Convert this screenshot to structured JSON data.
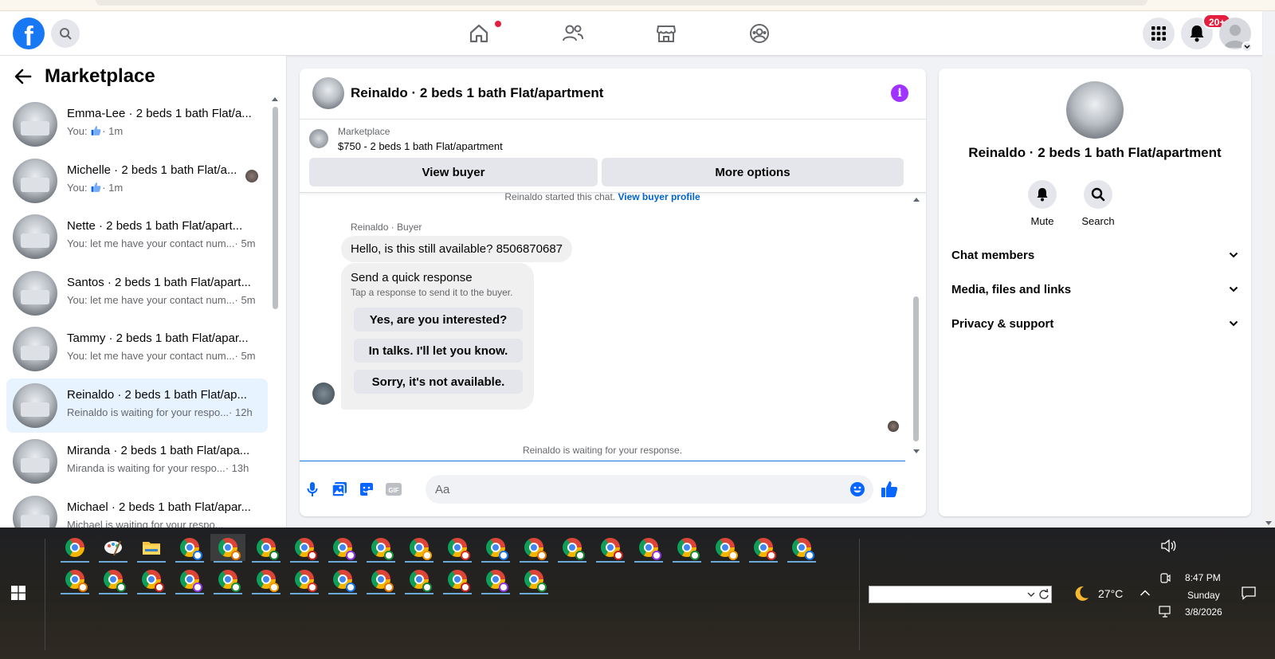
{
  "topnav": {
    "logo": "f",
    "notif_badge": "20+"
  },
  "marketplace": {
    "title": "Marketplace",
    "conversations": [
      {
        "name": "Emma-Lee · 2 beds 1 bath Flat/a...",
        "preview": "You: ",
        "preview_icon": "thumbs-up-icon",
        "time": "· 1m",
        "active": false
      },
      {
        "name": "Michelle · 2 beds 1 bath Flat/a...",
        "preview": "You: ",
        "preview_icon": "thumbs-up-icon",
        "time": "· 1m",
        "active": false
      },
      {
        "name": "Nette · 2 beds 1 bath Flat/apart...",
        "preview": "You: let me have your contact num...",
        "time": "· 5m",
        "active": false
      },
      {
        "name": "Santos · 2 beds 1 bath Flat/apart...",
        "preview": "You: let me have your contact num...",
        "time": "· 5m",
        "active": false
      },
      {
        "name": "Tammy · 2 beds 1 bath Flat/apar...",
        "preview": "You: let me have your contact num...",
        "time": "· 5m",
        "active": false
      },
      {
        "name": "Reinaldo · 2 beds 1 bath Flat/ap...",
        "preview": "Reinaldo is waiting for your respo...",
        "time": "· 12h",
        "active": true
      },
      {
        "name": "Miranda · 2 beds 1 bath Flat/apa...",
        "preview": "Miranda is waiting for your respo...",
        "time": "· 13h",
        "active": false
      },
      {
        "name": "Michael · 2 beds 1 bath Flat/apar...",
        "preview": "Michael is waiting for your respo...",
        "time": "",
        "active": false
      }
    ]
  },
  "chat": {
    "title": "Reinaldo · 2 beds 1 bath Flat/apartment",
    "listing_label": "Marketplace",
    "listing_price": "$750 - 2 beds 1 bath Flat/apartment",
    "view_buyer": "View buyer",
    "more_options": "More options",
    "started_text": "Reinaldo started this chat.",
    "view_buyer_profile": "View buyer profile",
    "sender_label": "Reinaldo · Buyer",
    "message": "Hello, is this still available? 8506870687",
    "quick_title": "Send a quick response",
    "quick_sub": "Tap a response to send it to the buyer.",
    "quick_options": [
      "Yes, are you interested?",
      "In talks. I'll let you know.",
      "Sorry, it's not available."
    ],
    "waiting": "Reinaldo is waiting for your response.",
    "composer_placeholder": "Aa",
    "accent_color": "#0866ff"
  },
  "details": {
    "name": "Reinaldo · 2 beds 1 bath Flat/apartment",
    "mute": "Mute",
    "search": "Search",
    "sections": [
      "Chat members",
      "Media, files and links",
      "Privacy & support"
    ]
  },
  "taskbar": {
    "temperature": "27°C",
    "time": "8:47 PM",
    "day": "Sunday",
    "date": "3/8/2026"
  }
}
